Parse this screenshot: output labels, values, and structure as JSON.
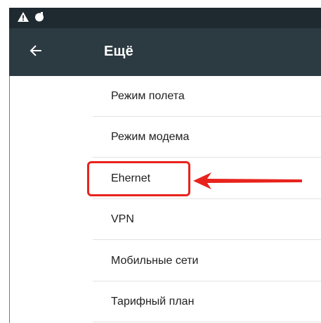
{
  "status_bar": {
    "icons": [
      "warning-icon",
      "notification-dot-icon"
    ]
  },
  "header": {
    "title": "Ещё",
    "back_icon": "arrow-back-icon"
  },
  "menu": {
    "items": [
      {
        "label": "Режим полета"
      },
      {
        "label": "Режим модема"
      },
      {
        "label": "Ehernet"
      },
      {
        "label": "VPN"
      },
      {
        "label": "Мобильные сети"
      },
      {
        "label": "Тарифный план"
      }
    ]
  },
  "annotation": {
    "highlight_color": "#e8231c",
    "highlighted_item_index": 2
  },
  "colors": {
    "status_bar": "#1e2a30",
    "app_bar": "#2c3a41",
    "text_primary": "#212121",
    "divider": "#e3e3e3"
  }
}
